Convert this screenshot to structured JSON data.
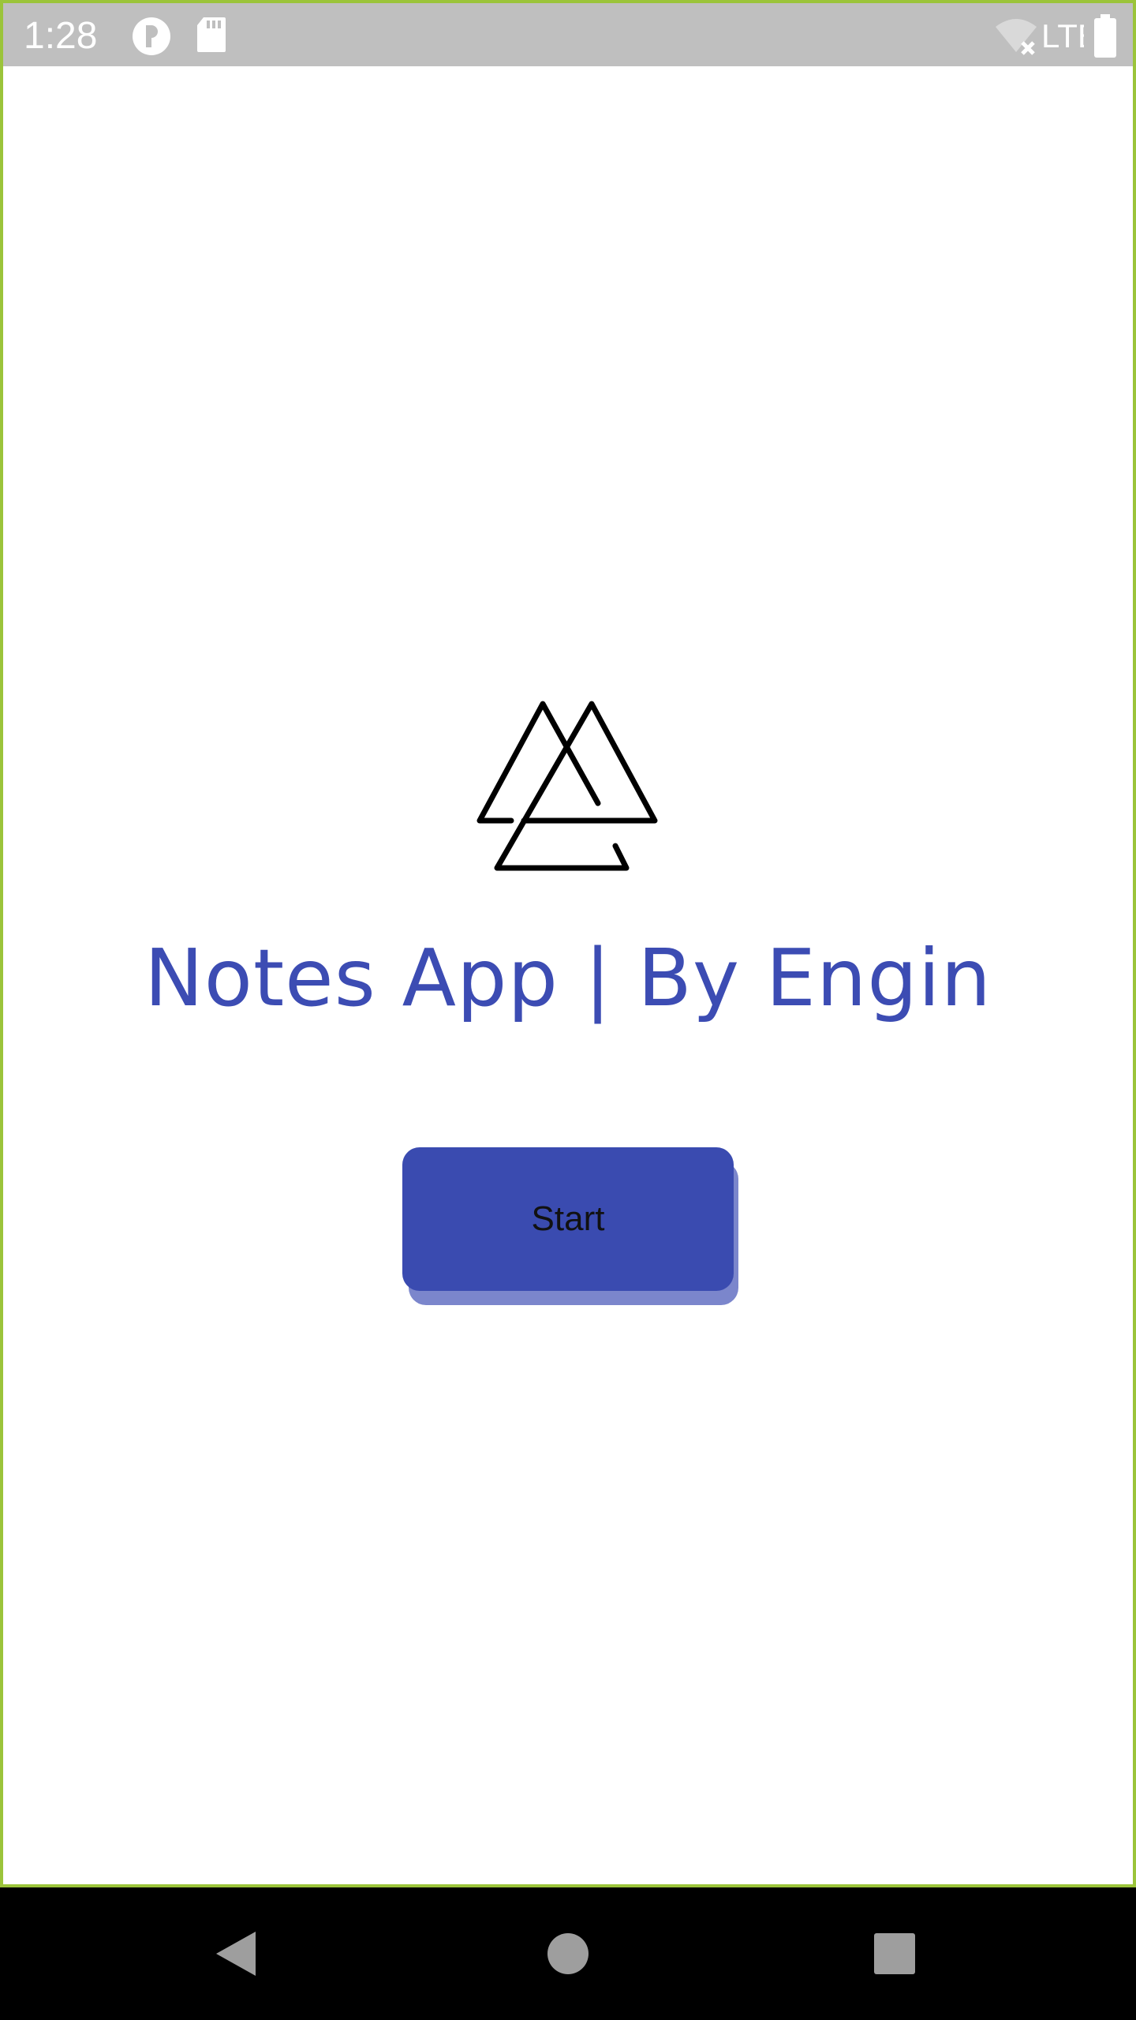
{
  "status_bar": {
    "time": "1:28",
    "icons": [
      "app-notification-icon",
      "sd-card-icon",
      "wifi-off-icon",
      "lte-icon",
      "battery-icon"
    ],
    "network_label": "LTE"
  },
  "main": {
    "logo_icon": "triangles-logo-icon",
    "title": "Notes App | By Engin",
    "start_label": "Start"
  },
  "nav_bar": {
    "icons": [
      "back-icon",
      "home-icon",
      "recents-icon"
    ]
  },
  "colors": {
    "accent": "#3a4bb0",
    "title": "#3c4cb3",
    "button_shadow": "#7b86cc",
    "status_bar": "#bfbfbf",
    "frame": "#9bc43a"
  }
}
